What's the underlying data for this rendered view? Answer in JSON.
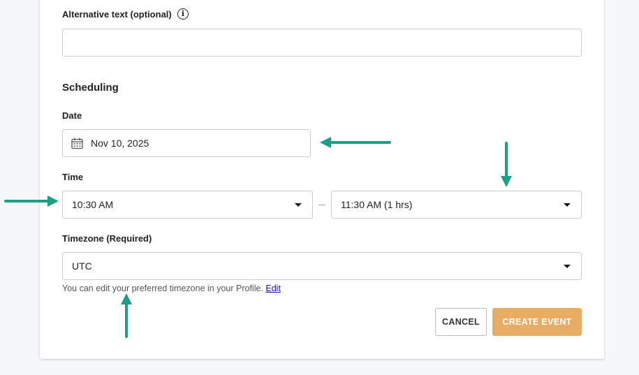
{
  "alt_text": {
    "label": "Alternative text (optional)",
    "value": ""
  },
  "scheduling": {
    "title": "Scheduling",
    "date_label": "Date",
    "date_value": "Nov 10, 2025",
    "time_label": "Time",
    "start_time": "10:30 AM",
    "end_time": "11:30 AM (1 hrs)",
    "timezone_label": "Timezone (Required)",
    "timezone_value": "UTC",
    "helper_text": "You can edit your preferred timezone in your Profile.",
    "helper_link": "Edit"
  },
  "actions": {
    "cancel_label": "CANCEL",
    "create_label": "CREATE EVENT"
  },
  "colors": {
    "primary_button": "#e8ad65",
    "annotation_arrow": "#1e9e86"
  },
  "icons": [
    "info-icon",
    "calendar-icon",
    "chevron-down-icon",
    "arrow-annotation"
  ]
}
